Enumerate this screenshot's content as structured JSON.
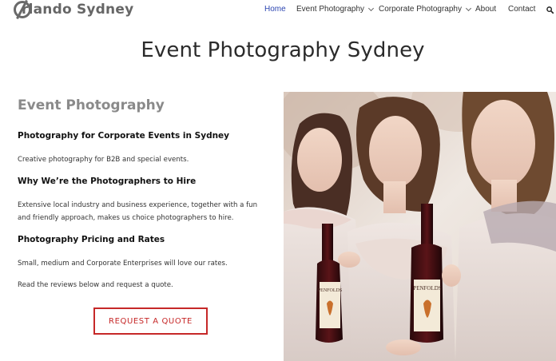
{
  "header": {
    "logo_text": "rlando Sydney",
    "nav": [
      {
        "label": "Home",
        "active": true,
        "dropdown": false
      },
      {
        "label": "Event Photography",
        "active": false,
        "dropdown": true
      },
      {
        "label": "Corporate Photography",
        "active": false,
        "dropdown": true
      },
      {
        "label": "About",
        "active": false,
        "dropdown": false
      },
      {
        "label": "Contact",
        "active": false,
        "dropdown": false
      }
    ],
    "search_icon": "search-icon"
  },
  "page_title": "Event Photography Sydney",
  "content": {
    "heading": "Event Photography",
    "sections": [
      {
        "title": "Photography for Corporate Events in Sydney",
        "text": "Creative photography for B2B and special events."
      },
      {
        "title": "Why We’re the Photographers to Hire",
        "text": "Extensive local industry and business experience, together with a fun and friendly approach, makes us choice photographers to hire."
      },
      {
        "title": "Photography Pricing and Rates",
        "text": "Small, medium and Corporate Enterprises will love our rates."
      }
    ],
    "closing_text": "Read the reviews below and request a quote.",
    "cta_label": "REQUEST A QUOTE"
  },
  "photo": {
    "bottle_label": "PENFOLDS"
  },
  "colors": {
    "nav_active": "#2c46b1",
    "cta": "#c62828",
    "heading_grey": "#8a8a8a"
  }
}
